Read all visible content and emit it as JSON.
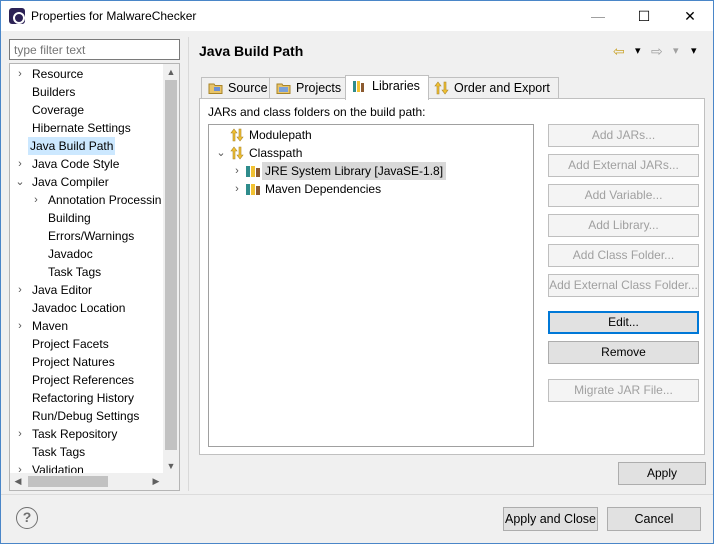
{
  "window": {
    "title": "Properties for MalwareChecker",
    "minimize_glyph": "—",
    "maximize_glyph": "☐",
    "close_glyph": "✕"
  },
  "left": {
    "filter_placeholder": "type filter text",
    "items": [
      {
        "label": "Resource",
        "twistie": "›"
      },
      {
        "label": "Builders",
        "twistie": ""
      },
      {
        "label": "Coverage",
        "twistie": ""
      },
      {
        "label": "Hibernate Settings",
        "twistie": ""
      },
      {
        "label": "Java Build Path",
        "twistie": "",
        "selected": true
      },
      {
        "label": "Java Code Style",
        "twistie": "›"
      },
      {
        "label": "Java Compiler",
        "twistie": "⌄"
      },
      {
        "label": "Annotation Processin",
        "twistie": "›"
      },
      {
        "label": "Building",
        "twistie": ""
      },
      {
        "label": "Errors/Warnings",
        "twistie": ""
      },
      {
        "label": "Javadoc",
        "twistie": ""
      },
      {
        "label": "Task Tags",
        "twistie": ""
      },
      {
        "label": "Java Editor",
        "twistie": "›"
      },
      {
        "label": "Javadoc Location",
        "twistie": ""
      },
      {
        "label": "Maven",
        "twistie": "›"
      },
      {
        "label": "Project Facets",
        "twistie": ""
      },
      {
        "label": "Project Natures",
        "twistie": ""
      },
      {
        "label": "Project References",
        "twistie": ""
      },
      {
        "label": "Refactoring History",
        "twistie": ""
      },
      {
        "label": "Run/Debug Settings",
        "twistie": ""
      },
      {
        "label": "Task Repository",
        "twistie": "›"
      },
      {
        "label": "Task Tags",
        "twistie": ""
      },
      {
        "label": "Validation",
        "twistie": "›"
      }
    ]
  },
  "right": {
    "title": "Java Build Path",
    "nav": {
      "back": "⇦",
      "back_menu": "▾",
      "forward": "⇨",
      "forward_menu": "▾",
      "view_menu": "▾"
    },
    "tabs": [
      {
        "label": "Source",
        "icon": "source-folder-icon"
      },
      {
        "label": "Projects",
        "icon": "projects-icon"
      },
      {
        "label": "Libraries",
        "icon": "libraries-icon",
        "active": true
      },
      {
        "label": "Order and Export",
        "icon": "order-export-icon"
      }
    ],
    "jars_label": "JARs and class folders on the build path:",
    "tree": [
      {
        "label": "Modulepath",
        "twistie": "",
        "icon": "modulepath-icon"
      },
      {
        "label": "Classpath",
        "twistie": "⌄",
        "icon": "classpath-icon"
      },
      {
        "label": "JRE System Library [JavaSE-1.8]",
        "twistie": "›",
        "icon": "library-icon",
        "selected": true
      },
      {
        "label": "Maven Dependencies",
        "twistie": "›",
        "icon": "library-icon"
      }
    ],
    "buttons": [
      {
        "label": "Add JARs...",
        "enabled": false
      },
      {
        "label": "Add External JARs...",
        "enabled": false
      },
      {
        "label": "Add Variable...",
        "enabled": false
      },
      {
        "label": "Add Library...",
        "enabled": false
      },
      {
        "label": "Add Class Folder...",
        "enabled": false
      },
      {
        "label": "Add External Class Folder...",
        "enabled": false
      },
      {
        "label": "Edit...",
        "enabled": true,
        "focused": true
      },
      {
        "label": "Remove",
        "enabled": true
      },
      {
        "label": "Migrate JAR File...",
        "enabled": false
      }
    ],
    "apply_label": "Apply"
  },
  "footer": {
    "help": "?",
    "apply_close": "Apply and Close",
    "cancel": "Cancel"
  },
  "colors": {
    "selection": "#cce8ff",
    "focus": "#0078d7",
    "library_yellow": "#f2c233",
    "library_teal": "#2f8c8c"
  }
}
